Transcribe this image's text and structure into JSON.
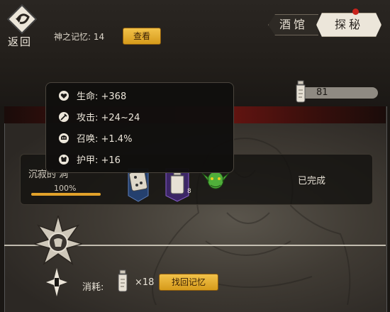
{
  "header": {
    "back_label": "返回",
    "memory_label": "神之记忆: 14",
    "view_button": "查看"
  },
  "tabs": [
    {
      "label": "酒馆",
      "active": false
    },
    {
      "label": "探秘",
      "active": true,
      "has_notification": true
    }
  ],
  "resource": {
    "icon": "bottle-icon",
    "count": "81"
  },
  "tooltip": {
    "stats": [
      {
        "icon": "heart-icon",
        "text": "生命: +368"
      },
      {
        "icon": "sword-icon",
        "text": "攻击: +24~24"
      },
      {
        "icon": "summon-skull-icon",
        "text": "召唤: +1.4%"
      },
      {
        "icon": "armor-icon",
        "text": "护甲: +16"
      }
    ]
  },
  "quest": {
    "name": "沉寂的 洞",
    "progress_text": "100%",
    "progress": 1.0,
    "status": "已完成",
    "rewards": [
      {
        "icon": "dice-scroll-icon",
        "count": ""
      },
      {
        "icon": "bottle-icon",
        "count": "8"
      },
      {
        "icon": "goblin-head-icon",
        "count": ""
      }
    ]
  },
  "cost": {
    "label": "消耗:",
    "icon": "bottle-icon",
    "multiplier": "×18",
    "button": "找回记忆"
  },
  "colors": {
    "gold_button": "#e0aa2c",
    "accent_red": "#6b1512",
    "notification": "#c8231c",
    "progress_fill": "#e2a22a"
  }
}
